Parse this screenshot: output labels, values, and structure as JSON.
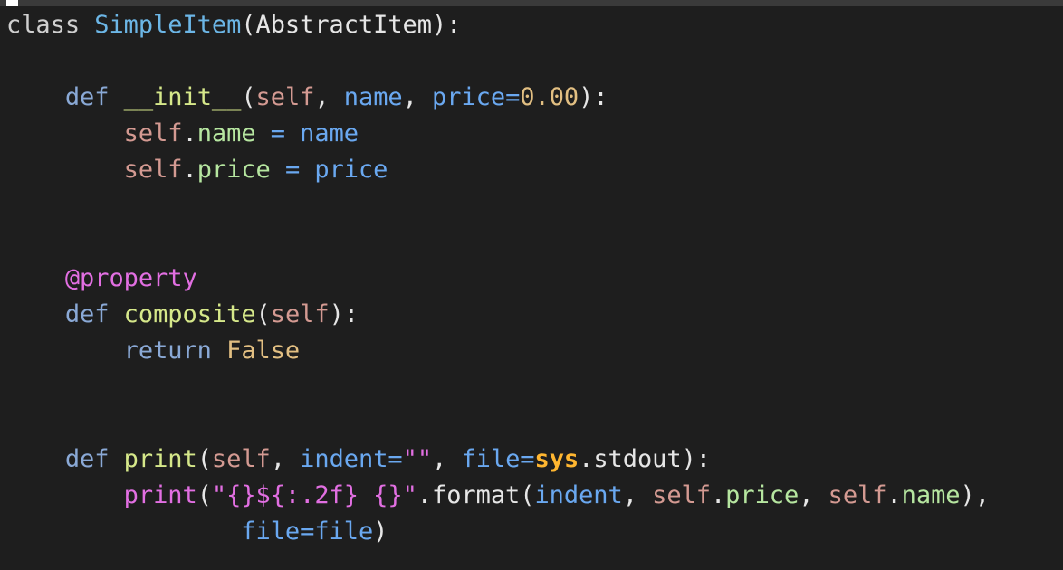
{
  "editor": {
    "colors": {
      "background": "#1e1e1e",
      "keyword": "#8aa9d6",
      "class_name": "#6cb6e6",
      "function_name": "#d6e88a",
      "default": "#e6e6e6",
      "self": "#d49a92",
      "parameter": "#6aa8f0",
      "number": "#e2bf82",
      "decorator": "#e26fe2",
      "attribute": "#b6e6a0",
      "string": "#e26fe2",
      "bold_module": "#ffb630"
    },
    "lines": [
      {
        "tokens": [
          {
            "text": "class ",
            "color": "#cfcfcf"
          },
          {
            "text": "SimpleItem",
            "color": "#6cb6e6"
          },
          {
            "text": "(AbstractItem):",
            "color": "#e6e6e6"
          }
        ]
      },
      {
        "tokens": []
      },
      {
        "tokens": [
          {
            "text": "    ",
            "color": "#e6e6e6"
          },
          {
            "text": "def",
            "color": "#8aa9d6"
          },
          {
            "text": " ",
            "color": "#e6e6e6"
          },
          {
            "text": "__init__",
            "color": "#d6e88a"
          },
          {
            "text": "(",
            "color": "#e6e6e6"
          },
          {
            "text": "self",
            "color": "#d49a92"
          },
          {
            "text": ", ",
            "color": "#e6e6e6"
          },
          {
            "text": "name",
            "color": "#6aa8f0"
          },
          {
            "text": ", ",
            "color": "#e6e6e6"
          },
          {
            "text": "price",
            "color": "#6aa8f0"
          },
          {
            "text": "=",
            "color": "#6aa8f0"
          },
          {
            "text": "0.00",
            "color": "#e2bf82"
          },
          {
            "text": "):",
            "color": "#e6e6e6"
          }
        ]
      },
      {
        "tokens": [
          {
            "text": "        ",
            "color": "#e6e6e6"
          },
          {
            "text": "self",
            "color": "#d49a92"
          },
          {
            "text": ".",
            "color": "#e6e6e6"
          },
          {
            "text": "name",
            "color": "#b6e6a0"
          },
          {
            "text": " = ",
            "color": "#6aa8f0"
          },
          {
            "text": "name",
            "color": "#6aa8f0"
          }
        ]
      },
      {
        "tokens": [
          {
            "text": "        ",
            "color": "#e6e6e6"
          },
          {
            "text": "self",
            "color": "#d49a92"
          },
          {
            "text": ".",
            "color": "#e6e6e6"
          },
          {
            "text": "price",
            "color": "#b6e6a0"
          },
          {
            "text": " = ",
            "color": "#6aa8f0"
          },
          {
            "text": "price",
            "color": "#6aa8f0"
          }
        ]
      },
      {
        "tokens": []
      },
      {
        "tokens": []
      },
      {
        "tokens": [
          {
            "text": "    ",
            "color": "#e6e6e6"
          },
          {
            "text": "@property",
            "color": "#e26fe2"
          }
        ]
      },
      {
        "tokens": [
          {
            "text": "    ",
            "color": "#e6e6e6"
          },
          {
            "text": "def",
            "color": "#8aa9d6"
          },
          {
            "text": " ",
            "color": "#e6e6e6"
          },
          {
            "text": "composite",
            "color": "#d6e88a"
          },
          {
            "text": "(",
            "color": "#e6e6e6"
          },
          {
            "text": "self",
            "color": "#d49a92"
          },
          {
            "text": "):",
            "color": "#e6e6e6"
          }
        ]
      },
      {
        "tokens": [
          {
            "text": "        ",
            "color": "#e6e6e6"
          },
          {
            "text": "return",
            "color": "#8aa9d6"
          },
          {
            "text": " ",
            "color": "#e6e6e6"
          },
          {
            "text": "False",
            "color": "#e2bf82"
          }
        ]
      },
      {
        "tokens": []
      },
      {
        "tokens": []
      },
      {
        "tokens": [
          {
            "text": "    ",
            "color": "#e6e6e6"
          },
          {
            "text": "def",
            "color": "#8aa9d6"
          },
          {
            "text": " ",
            "color": "#e6e6e6"
          },
          {
            "text": "print",
            "color": "#d6e88a"
          },
          {
            "text": "(",
            "color": "#e6e6e6"
          },
          {
            "text": "self",
            "color": "#d49a92"
          },
          {
            "text": ", ",
            "color": "#e6e6e6"
          },
          {
            "text": "indent",
            "color": "#6aa8f0"
          },
          {
            "text": "=",
            "color": "#6aa8f0"
          },
          {
            "text": "\"\"",
            "color": "#e26fe2"
          },
          {
            "text": ", ",
            "color": "#e6e6e6"
          },
          {
            "text": "file",
            "color": "#6aa8f0"
          },
          {
            "text": "=",
            "color": "#6aa8f0"
          },
          {
            "text": "sys",
            "color": "#ffb630",
            "bold": true
          },
          {
            "text": ".stdout):",
            "color": "#e6e6e6"
          }
        ]
      },
      {
        "tokens": [
          {
            "text": "        ",
            "color": "#e6e6e6"
          },
          {
            "text": "print",
            "color": "#e26fe2"
          },
          {
            "text": "(",
            "color": "#e6e6e6"
          },
          {
            "text": "\"{}${:.2f} {}\"",
            "color": "#e26fe2"
          },
          {
            "text": ".format(",
            "color": "#e6e6e6"
          },
          {
            "text": "indent",
            "color": "#6aa8f0"
          },
          {
            "text": ", ",
            "color": "#e6e6e6"
          },
          {
            "text": "self",
            "color": "#d49a92"
          },
          {
            "text": ".",
            "color": "#e6e6e6"
          },
          {
            "text": "price",
            "color": "#b6e6a0"
          },
          {
            "text": ", ",
            "color": "#e6e6e6"
          },
          {
            "text": "self",
            "color": "#d49a92"
          },
          {
            "text": ".",
            "color": "#e6e6e6"
          },
          {
            "text": "name",
            "color": "#b6e6a0"
          },
          {
            "text": "),",
            "color": "#e6e6e6"
          }
        ]
      },
      {
        "tokens": [
          {
            "text": "                ",
            "color": "#e6e6e6"
          },
          {
            "text": "file",
            "color": "#6aa8f0"
          },
          {
            "text": "=",
            "color": "#6aa8f0"
          },
          {
            "text": "file",
            "color": "#6aa8f0"
          },
          {
            "text": ")",
            "color": "#e6e6e6"
          }
        ]
      }
    ]
  }
}
